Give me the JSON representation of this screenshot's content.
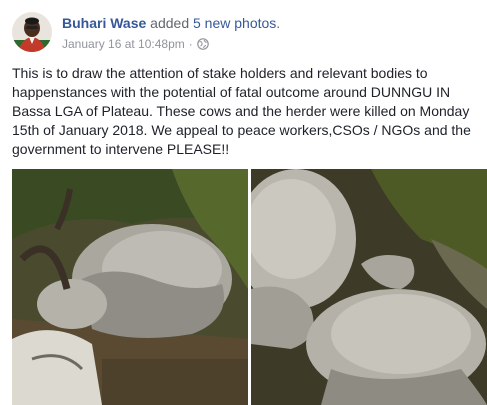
{
  "post": {
    "author": "Buhari Wase",
    "action_prefix": "added",
    "action_link": "5 new photos",
    "action_suffix": ".",
    "timestamp": "January 16 at 10:48pm",
    "separator": "·",
    "privacy_icon": "globe-icon",
    "text": "This is to draw the attention of stake holders and relevant bodies to happenstances with the potential of fatal outcome around DUNNGU IN Bassa LGA of Plateau. These cows and the herder were killed on Monday 15th of January 2018. We appeal to peace workers,CSOs / NGOs and the government to intervene PLEASE!!"
  },
  "colors": {
    "link": "#365899",
    "meta": "#90949c",
    "text": "#1d2129"
  }
}
